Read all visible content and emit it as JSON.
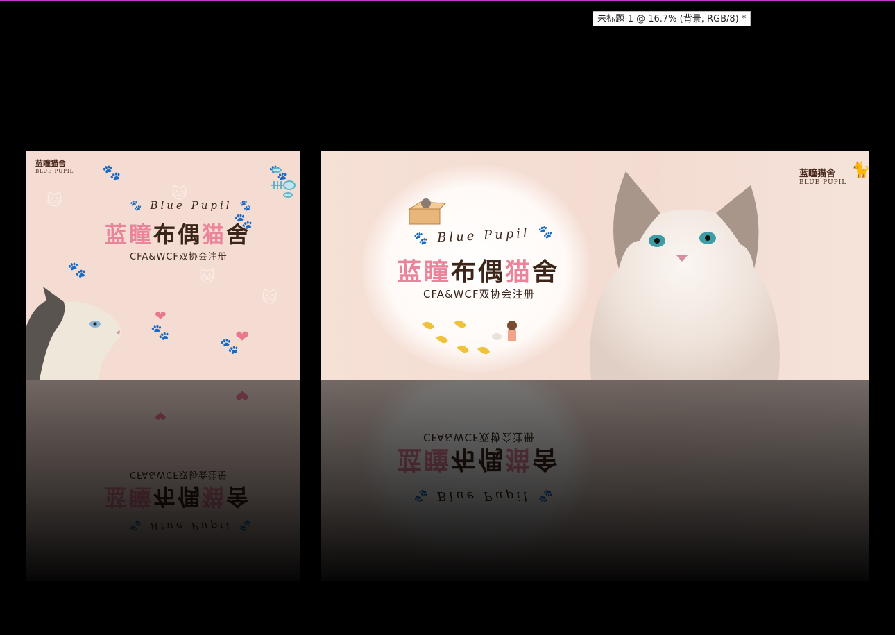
{
  "window": {
    "tab_title": "未标题-1 @ 16.7% (背景, RGB/8) *",
    "accent": "#c03cc8"
  },
  "brand": {
    "cn": "蓝瞳猫舍",
    "en": "BLUE PUPIL"
  },
  "left_card": {
    "title_en": "Blue  Pupil",
    "title_cn_parts": [
      "蓝",
      "瞳",
      "布偶",
      "猫",
      "舍"
    ],
    "subtitle": "CFA&WCF双协会注册"
  },
  "right_card": {
    "title_en": "Blue  Pupil",
    "title_cn_parts": [
      "蓝",
      "瞳",
      "布偶",
      "猫",
      "舍"
    ],
    "subtitle": "CFA&WCF双协会注册"
  },
  "icons": [
    "paw-icon",
    "heart-icon",
    "fish-bone-icon",
    "cat-icon",
    "ginkgo-leaf-icon"
  ],
  "colors": {
    "pink": "#e9849b",
    "brown": "#3b2418",
    "card_bg": "#f4dcd2"
  }
}
